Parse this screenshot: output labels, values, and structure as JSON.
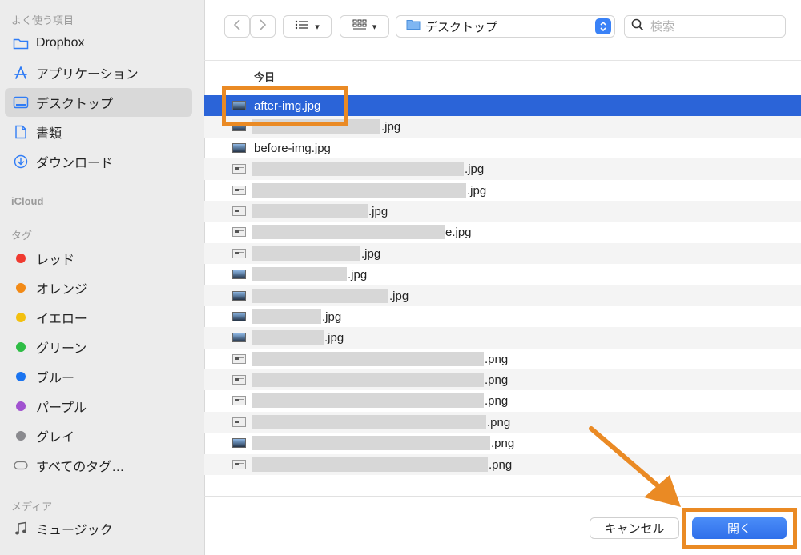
{
  "sidebar": {
    "favorites_title": "よく使う項目",
    "favorites": [
      {
        "label": "Dropbox",
        "icon": "folder-icon"
      },
      {
        "label": "アプリケーション",
        "icon": "applications-icon"
      },
      {
        "label": "デスクトップ",
        "icon": "desktop-icon",
        "selected": true
      },
      {
        "label": "書類",
        "icon": "document-icon"
      },
      {
        "label": "ダウンロード",
        "icon": "download-icon"
      }
    ],
    "icloud_title": "iCloud",
    "tags_title": "タグ",
    "tags": [
      {
        "label": "レッド",
        "color": "#f03a30"
      },
      {
        "label": "オレンジ",
        "color": "#f28a16"
      },
      {
        "label": "イエロー",
        "color": "#f3c00f"
      },
      {
        "label": "グリーン",
        "color": "#2ebd45"
      },
      {
        "label": "ブルー",
        "color": "#1a74f0"
      },
      {
        "label": "パープル",
        "color": "#a152d0"
      },
      {
        "label": "グレイ",
        "color": "#8a8a8e"
      },
      {
        "label": "すべてのタグ…",
        "icon": "all-tags-icon"
      }
    ],
    "media_title": "メディア",
    "media": [
      {
        "label": "ミュージック",
        "icon": "music-icon"
      }
    ]
  },
  "toolbar": {
    "location": "デスクトップ",
    "search_placeholder": "検索"
  },
  "list": {
    "group_header": "今日",
    "files": [
      {
        "name": "after-img.jpg",
        "thumb": "photo",
        "selected": true
      },
      {
        "name": ".jpg",
        "thumb": "photo"
      },
      {
        "name": "before-img.jpg",
        "thumb": "photo"
      },
      {
        "name": ".jpg",
        "thumb": "screen"
      },
      {
        "name": ".jpg",
        "thumb": "screen"
      },
      {
        "name": ".jpg",
        "thumb": "screen"
      },
      {
        "name": "e.jpg",
        "thumb": "screen"
      },
      {
        "name": ".jpg",
        "thumb": "screen"
      },
      {
        "name": ".jpg",
        "thumb": "photo"
      },
      {
        "name": ".jpg",
        "thumb": "photo"
      },
      {
        "name": ".jpg",
        "thumb": "photo"
      },
      {
        "name": ".jpg",
        "thumb": "photo"
      },
      {
        "name": ".png",
        "thumb": "screen"
      },
      {
        "name": ".png",
        "thumb": "screen"
      },
      {
        "name": ".png",
        "thumb": "screen"
      },
      {
        "name": ".png",
        "thumb": "screen"
      },
      {
        "name": ".png",
        "thumb": "photo"
      },
      {
        "name": ".png",
        "thumb": "screen"
      }
    ]
  },
  "buttons": {
    "cancel": "キャンセル",
    "open": "開く"
  },
  "colors": {
    "accent": "#2b64d8",
    "annotation": "#ea8a24"
  }
}
